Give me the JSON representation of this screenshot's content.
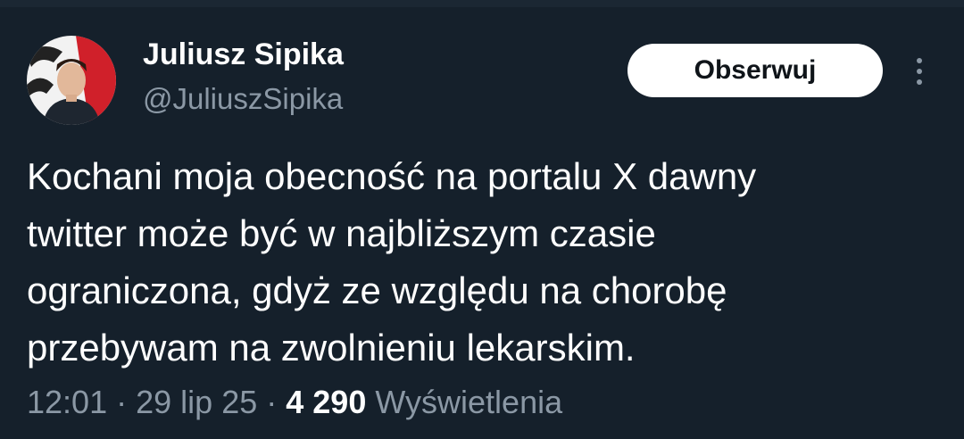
{
  "author": {
    "display_name": "Juliusz Sipika",
    "handle": "@JuliuszSipika"
  },
  "actions": {
    "follow_label": "Obserwuj",
    "more_icon": "more-vertical-icon"
  },
  "tweet": {
    "lines": [
      "Kochani moja obecność na portalu X dawny",
      "twitter może być w najbliższym czasie",
      "ograniczona, gdyż ze względu na chorobę",
      "przebywam na zwolnieniu lekarskim."
    ]
  },
  "meta": {
    "time": "12:01",
    "separator": "·",
    "date": "29 lip 25",
    "views_count": "4 290",
    "views_label": "Wyświetlenia"
  },
  "colors": {
    "background": "#15202b",
    "text_primary": "#ffffff",
    "text_secondary": "#8b98a5",
    "button_bg": "#ffffff",
    "avatar_accent": "#d0202a"
  }
}
